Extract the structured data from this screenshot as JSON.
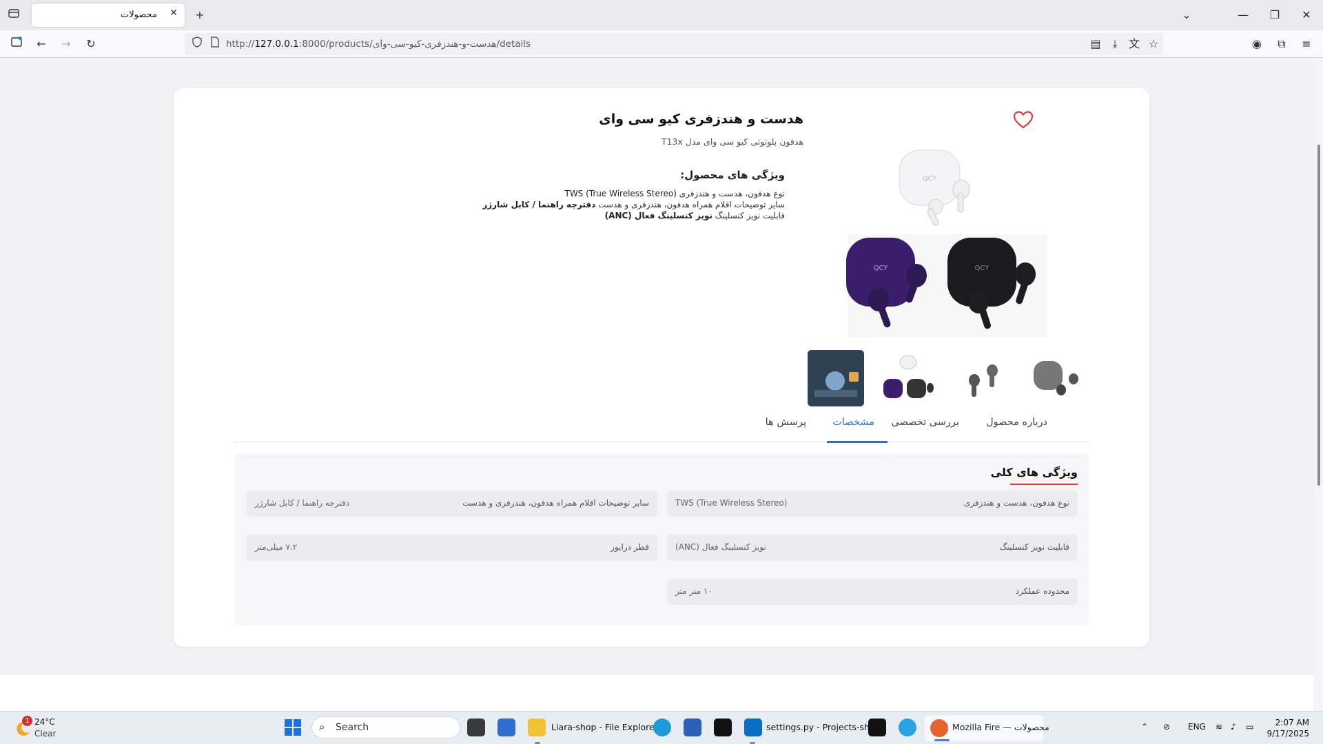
{
  "browser": {
    "tab_title": "محصولات",
    "url_prefix": "http://",
    "url_host": "127.0.0.1",
    "url_rest": ":8000/products/هدست-و-هندزفری-کیو-سی-وای/details"
  },
  "product": {
    "title": "هدست و هندزفری کیو سی وای",
    "subtitle": "هدفون بلوتوثی کیو سی وای مدل T13x",
    "features_title": "ویژگی های محصول:",
    "features": [
      {
        "key": "نوع هدفون، هدست و هندزفری",
        "value": "TWS (True Wireless Stereo)"
      },
      {
        "key": "سایر توضیحات اقلام همراه هدفون، هندزفری و هدست",
        "value": "دفترچه راهنما / کابل شارژر"
      },
      {
        "key": "قابلیت نویز کنسلینگ",
        "value": "نویز کنسلینگ فعال (ANC)"
      }
    ]
  },
  "tabs": [
    "درباره محصول",
    "بررسی تخصصی",
    "مشخصات",
    "پرسش ها"
  ],
  "active_tab": "مشخصات",
  "specs": {
    "title": "ویژگی های کلی",
    "rows": [
      {
        "key": "نوع هدفون، هدست و هندزفری",
        "value": "TWS (True Wireless Stereo)"
      },
      {
        "key": "سایر توضیحات اقلام همراه هدفون، هندزفری و هدست",
        "value": "دفترچه راهنما / کابل شارژر"
      },
      {
        "key": "قابلیت نویز کنسلینگ",
        "value": "نویز کنسلینگ فعال (ANC)"
      },
      {
        "key": "قطر درایور",
        "value": "۷.۲ میلی‌متر"
      },
      {
        "key": "محدوده عملکرد",
        "value": "۱۰ متر متر"
      }
    ]
  },
  "taskbar": {
    "weather_temp": "24°C",
    "weather_desc": "Clear",
    "weather_badge": "1",
    "search_placeholder": "Search",
    "explorer_label": "Liara-shop - File Explore",
    "vscode_label": "settings.py - Projects-sh",
    "firefox_label": "Mozilla Fire — محصولات",
    "lang": "ENG",
    "time": "2:07 AM",
    "date": "9/17/2025"
  },
  "colors": {
    "accent": "#2a6fd6",
    "heart": "#e53935",
    "title_underline": "#e53935"
  }
}
